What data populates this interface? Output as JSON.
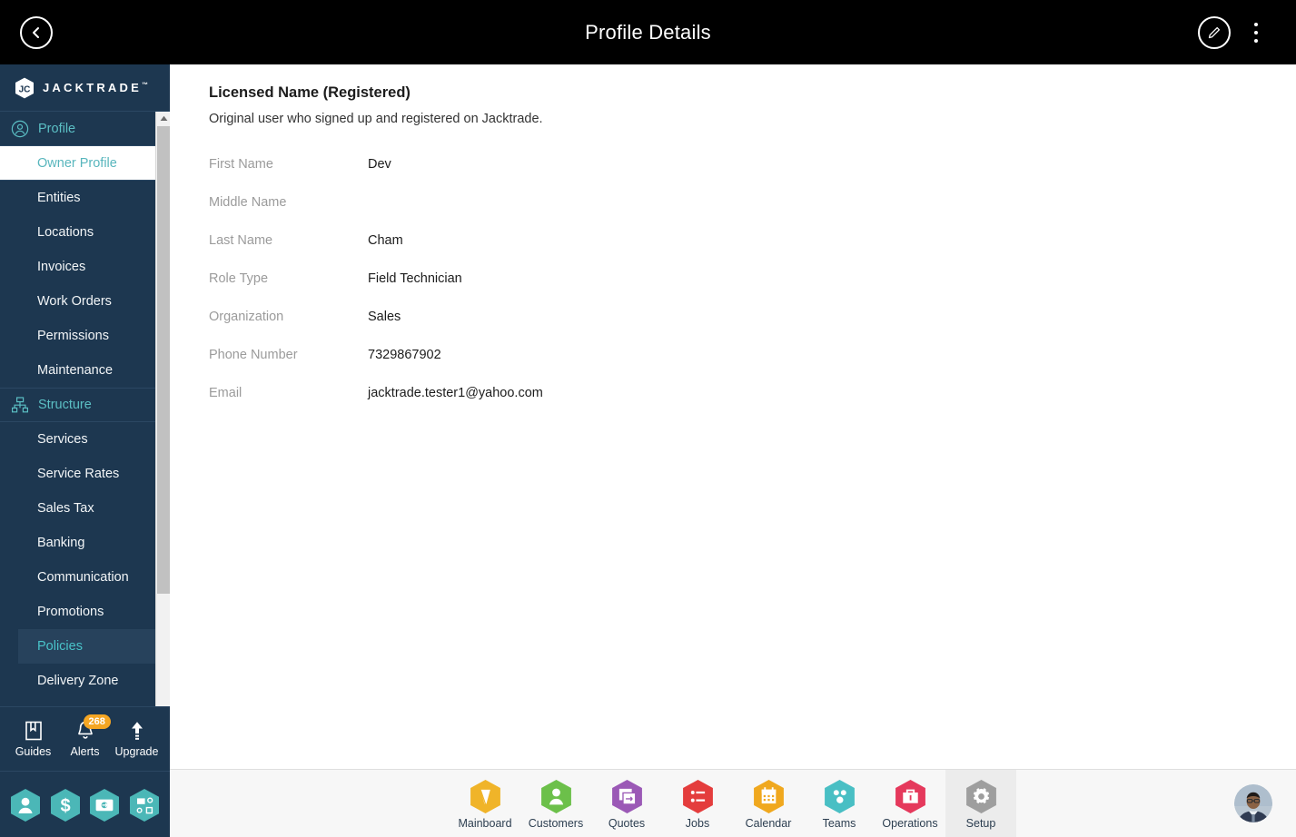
{
  "header": {
    "title": "Profile Details",
    "back_icon": "chevron-left-circle-icon",
    "edit_icon": "pencil-circle-icon",
    "menu_icon": "kebab-menu-icon"
  },
  "sidebar": {
    "brand": "JACKTRADE",
    "brand_tm": "™",
    "groups": [
      {
        "label": "Profile",
        "icon": "user-circle-icon",
        "items": [
          {
            "label": "Owner Profile",
            "state": "active"
          },
          {
            "label": "Entities",
            "state": "normal"
          },
          {
            "label": "Locations",
            "state": "normal"
          },
          {
            "label": "Invoices",
            "state": "normal"
          },
          {
            "label": "Work Orders",
            "state": "normal"
          },
          {
            "label": "Permissions",
            "state": "normal"
          },
          {
            "label": "Maintenance",
            "state": "normal"
          }
        ]
      },
      {
        "label": "Structure",
        "icon": "sitemap-icon",
        "items": [
          {
            "label": "Services",
            "state": "normal"
          },
          {
            "label": "Service Rates",
            "state": "normal"
          },
          {
            "label": "Sales Tax",
            "state": "normal"
          },
          {
            "label": "Banking",
            "state": "normal"
          },
          {
            "label": "Communication",
            "state": "normal"
          },
          {
            "label": "Promotions",
            "state": "normal"
          },
          {
            "label": "Policies",
            "state": "highlighted"
          },
          {
            "label": "Delivery Zone",
            "state": "normal"
          }
        ]
      }
    ],
    "tools": [
      {
        "label": "Guides",
        "icon": "book-icon",
        "badge": ""
      },
      {
        "label": "Alerts",
        "icon": "bell-icon",
        "badge": "268"
      },
      {
        "label": "Upgrade",
        "icon": "up-arrow-icon",
        "badge": ""
      }
    ],
    "quick_hexes": [
      {
        "icon": "person-hex-icon"
      },
      {
        "icon": "dollar-hex-icon"
      },
      {
        "icon": "money-transfer-hex-icon"
      },
      {
        "icon": "workflow-hex-icon"
      }
    ],
    "scrollbar": {
      "up_icon": "scroll-up-arrow-icon",
      "down_icon": "scroll-down-arrow-icon"
    }
  },
  "main": {
    "section_title": "Licensed Name (Registered)",
    "section_subtitle": "Original user who signed up and registered on Jacktrade.",
    "fields": [
      {
        "label": "First Name",
        "value": "Dev"
      },
      {
        "label": "Middle Name",
        "value": ""
      },
      {
        "label": "Last Name",
        "value": "Cham"
      },
      {
        "label": "Role Type",
        "value": "Field Technician"
      },
      {
        "label": "Organization",
        "value": "Sales"
      },
      {
        "label": "Phone Number",
        "value": "7329867902"
      },
      {
        "label": "Email",
        "value": "jacktrade.tester1@yahoo.com"
      }
    ]
  },
  "bottom_nav": {
    "tabs": [
      {
        "label": "Mainboard",
        "icon": "mainboard-hex-icon",
        "color": "#f0b429",
        "selected": false
      },
      {
        "label": "Customers",
        "icon": "customers-hex-icon",
        "color": "#6cc04a",
        "selected": false
      },
      {
        "label": "Quotes",
        "icon": "quotes-hex-icon",
        "color": "#9b59b6",
        "selected": false
      },
      {
        "label": "Jobs",
        "icon": "jobs-hex-icon",
        "color": "#e43d3d",
        "selected": false
      },
      {
        "label": "Calendar",
        "icon": "calendar-hex-icon",
        "color": "#f0a81e",
        "selected": false
      },
      {
        "label": "Teams",
        "icon": "teams-hex-icon",
        "color": "#49bfc4",
        "selected": false
      },
      {
        "label": "Operations",
        "icon": "operations-hex-icon",
        "color": "#e5395c",
        "selected": false
      },
      {
        "label": "Setup",
        "icon": "setup-gear-hex-icon",
        "color": "#9e9e9e",
        "selected": true
      }
    ],
    "avatar": "user-avatar"
  },
  "colors": {
    "sidebar_bg": "#1d3750",
    "accent_teal": "#49c3c9",
    "header_bg": "#000000",
    "badge_orange": "#f5a623",
    "bottom_bg": "#f7f7f7"
  }
}
